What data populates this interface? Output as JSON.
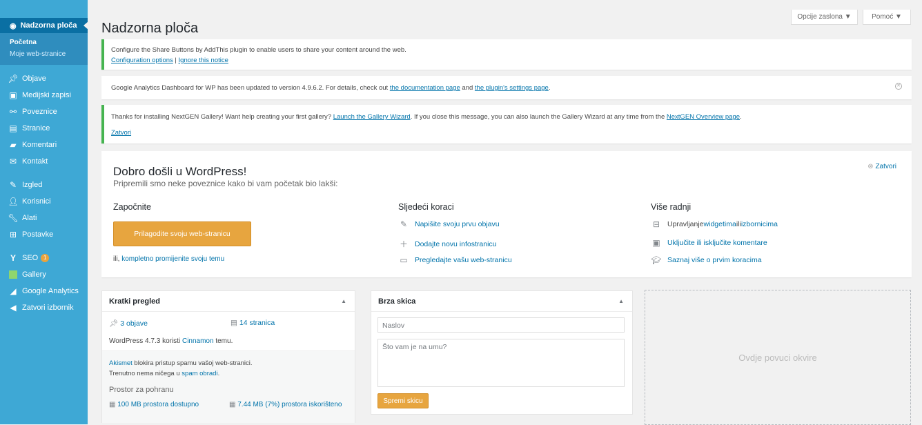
{
  "sidebar": {
    "dashboard": "Nadzorna ploča",
    "sub": [
      "Početna",
      "Moje web-stranice"
    ],
    "items1": [
      {
        "label": "Objave",
        "icon": "pin-icon"
      },
      {
        "label": "Medijski zapisi",
        "icon": "media-icon"
      },
      {
        "label": "Poveznice",
        "icon": "link-icon"
      },
      {
        "label": "Stranice",
        "icon": "page-icon"
      },
      {
        "label": "Komentari",
        "icon": "comment-icon"
      },
      {
        "label": "Kontakt",
        "icon": "mail-icon"
      }
    ],
    "items2": [
      {
        "label": "Izgled",
        "icon": "brush-icon"
      },
      {
        "label": "Korisnici",
        "icon": "user-icon"
      },
      {
        "label": "Alati",
        "icon": "wrench-icon"
      },
      {
        "label": "Postavke",
        "icon": "settings-icon"
      }
    ],
    "seo": "SEO",
    "seo_badge": "1",
    "gallery": "Gallery",
    "ga": "Google Analytics",
    "collapse": "Zatvori izbornik"
  },
  "top": {
    "screen_options": "Opcije zaslona ▼",
    "help": "Pomoć ▼"
  },
  "page_title": "Nadzorna ploča",
  "notices": {
    "addthis": {
      "text": "Configure the Share Buttons by AddThis plugin to enable users to share your content around the web.",
      "link1": "Configuration options",
      "sep": " | ",
      "link2": "Ignore this notice"
    },
    "ga": {
      "text1": "Google Analytics Dashboard for WP has been updated to version 4.9.6.2. For details, check out ",
      "link1": "the documentation page",
      "text2": " and ",
      "link2": "the plugin's settings page",
      "text3": "."
    },
    "nextgen": {
      "text1": "Thanks for installing NextGEN Gallery! Want help creating your first gallery? ",
      "link1": "Launch the Gallery Wizard",
      "text2": ". If you close this message, you can also launch the Gallery Wizard at any time from the ",
      "link2": "NextGEN Overview page",
      "text3": ".",
      "close": "Zatvori"
    }
  },
  "welcome": {
    "title": "Dobro došli u WordPress!",
    "about": "Pripremili smo neke poveznice kako bi vam početak bio lakši:",
    "dismiss": "Zatvori",
    "col1": {
      "heading": "Započnite",
      "button": "Prilagodite svoju web-stranicu",
      "alt_prefix": "ili, ",
      "alt_link": "kompletno promijenite svoju temu"
    },
    "col2": {
      "heading": "Sljedeći koraci",
      "links": [
        "Napišite svoju prvu objavu",
        "Dodajte novu infostranicu",
        "Pregledajte vašu web-stranicu"
      ]
    },
    "col3": {
      "heading": "Više radnji",
      "l1_pre": "Upravljanje ",
      "l1_a": "widgetima",
      "l1_mid": " ili ",
      "l1_b": "izbornicima",
      "l2": "Uključite ili isključite komentare",
      "l3": "Saznaj više o prvim koracima"
    }
  },
  "glance": {
    "title": "Kratki pregled",
    "posts": "3 objave",
    "pages": "14 stranica",
    "theme_pre": "WordPress 4.7.3 koristi ",
    "theme_link": "Cinnamon",
    "theme_post": " temu.",
    "akismet_link": "Akismet",
    "akismet_text": " blokira pristup spamu vašoj web-stranici.",
    "spam_pre": "Trenutno nema ničega u ",
    "spam_link": "spam obradi",
    "spam_post": ".",
    "storage_title": "Prostor za pohranu",
    "storage_avail": "100 MB prostora dostupno",
    "storage_used": "7.44 MB (7%) prostora iskorišteno"
  },
  "quickdraft": {
    "title": "Brza skica",
    "title_placeholder": "Naslov",
    "content_placeholder": "Što vam je na umu?",
    "save": "Spremi skicu"
  },
  "dropzone": "Ovdje povuci okvire"
}
